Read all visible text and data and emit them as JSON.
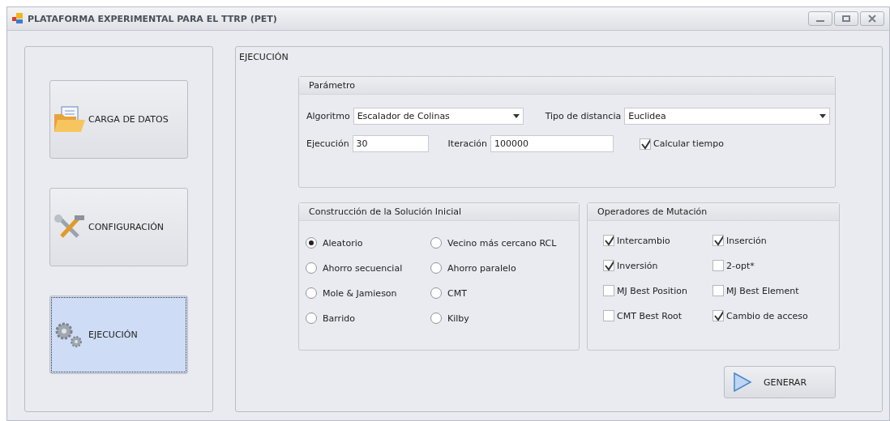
{
  "window": {
    "title": "PLATAFORMA EXPERIMENTAL PARA EL TTRP (PET)"
  },
  "nav": [
    {
      "label": "CARGA DE DATOS",
      "kind": "folder",
      "selected": false
    },
    {
      "label": "CONFIGURACIÓN",
      "kind": "tools",
      "selected": false
    },
    {
      "label": "EJECUCIÓN",
      "kind": "gears",
      "selected": true
    }
  ],
  "section_title": "EJECUCIÓN",
  "parametro": {
    "title": "Parámetro",
    "algoritmo": {
      "label": "Algoritmo",
      "value": "Escalador de Colinas"
    },
    "distancia": {
      "label": "Tipo de distancia",
      "value": "Euclidea"
    },
    "ejecucion": {
      "label": "Ejecución",
      "value": "30"
    },
    "iteracion": {
      "label": "Iteración",
      "value": "100000"
    },
    "calcular_tiempo": {
      "label": "Calcular tiempo",
      "checked": true
    }
  },
  "construccion": {
    "title": "Construcción de la Solución Inicial",
    "options": [
      {
        "label": "Aleatorio",
        "selected": true
      },
      {
        "label": "Vecino más cercano RCL",
        "selected": false
      },
      {
        "label": "Ahorro secuencial",
        "selected": false
      },
      {
        "label": "Ahorro paralelo",
        "selected": false
      },
      {
        "label": "Mole & Jamieson",
        "selected": false
      },
      {
        "label": "CMT",
        "selected": false
      },
      {
        "label": "Barrido",
        "selected": false
      },
      {
        "label": "Kilby",
        "selected": false
      }
    ]
  },
  "mutacion": {
    "title": "Operadores de Mutación",
    "options": [
      {
        "label": "Intercambio",
        "checked": true
      },
      {
        "label": "Inserción",
        "checked": true
      },
      {
        "label": "Inversión",
        "checked": true
      },
      {
        "label": "2-opt*",
        "checked": false
      },
      {
        "label": "MJ Best Position",
        "checked": false
      },
      {
        "label": "MJ Best Element",
        "checked": false
      },
      {
        "label": "CMT Best Root",
        "checked": false
      },
      {
        "label": "Cambio de acceso",
        "checked": true
      }
    ]
  },
  "generar_button": {
    "label": "GENERAR"
  }
}
